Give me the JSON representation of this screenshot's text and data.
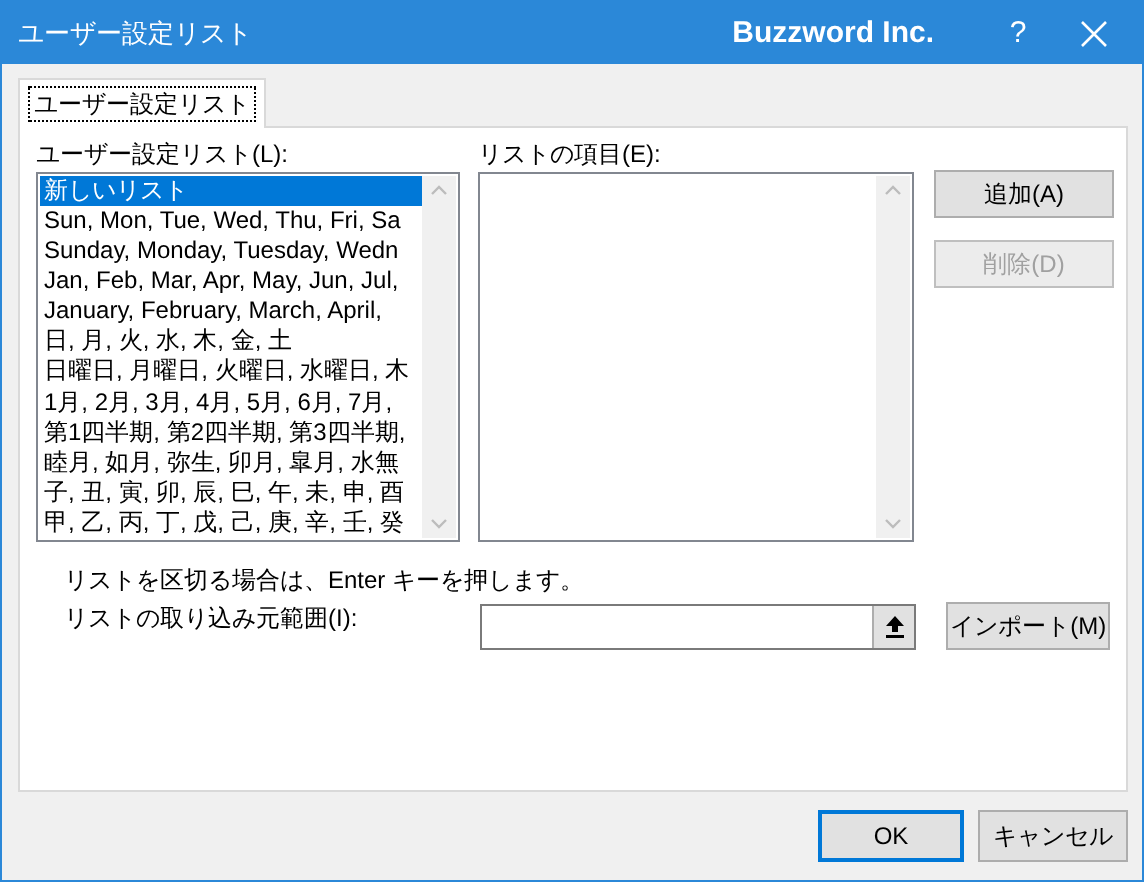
{
  "window": {
    "title": "ユーザー設定リスト",
    "brand": "Buzzword Inc.",
    "help": "?"
  },
  "tabs": [
    {
      "label": "ユーザー設定リスト",
      "selected": true
    }
  ],
  "custom_lists": {
    "label": "ユーザー設定リスト(L):",
    "items": [
      {
        "text": "新しいリスト",
        "selected": true
      },
      {
        "text": "Sun, Mon, Tue, Wed, Thu, Fri, Sa",
        "selected": false
      },
      {
        "text": "Sunday, Monday, Tuesday, Wedn",
        "selected": false
      },
      {
        "text": "Jan, Feb, Mar, Apr, May, Jun, Jul,",
        "selected": false
      },
      {
        "text": "January, February, March, April,",
        "selected": false
      },
      {
        "text": "日, 月, 火, 水, 木, 金, 土",
        "selected": false
      },
      {
        "text": "日曜日, 月曜日, 火曜日, 水曜日, 木",
        "selected": false
      },
      {
        "text": "1月, 2月, 3月, 4月, 5月, 6月, 7月,",
        "selected": false
      },
      {
        "text": "第1四半期, 第2四半期, 第3四半期,",
        "selected": false
      },
      {
        "text": "睦月, 如月, 弥生, 卯月, 皐月, 水無",
        "selected": false
      },
      {
        "text": "子, 丑, 寅, 卯, 辰, 巳, 午, 未, 申, 酉",
        "selected": false
      },
      {
        "text": "甲, 乙, 丙, 丁, 戊, 己, 庚, 辛, 壬, 癸",
        "selected": false
      }
    ]
  },
  "list_entries": {
    "label": "リストの項目(E):"
  },
  "side_buttons": [
    {
      "label": "追加(A)",
      "disabled": false
    },
    {
      "label": "削除(D)",
      "disabled": true
    }
  ],
  "hint": "リストを区切る場合は、Enter キーを押します。",
  "import_range": {
    "label": "リストの取り込み元範囲(I):",
    "button": "インポート(M)"
  },
  "footer_buttons": [
    {
      "label": "OK",
      "default": true
    },
    {
      "label": "キャンセル",
      "default": false
    }
  ]
}
